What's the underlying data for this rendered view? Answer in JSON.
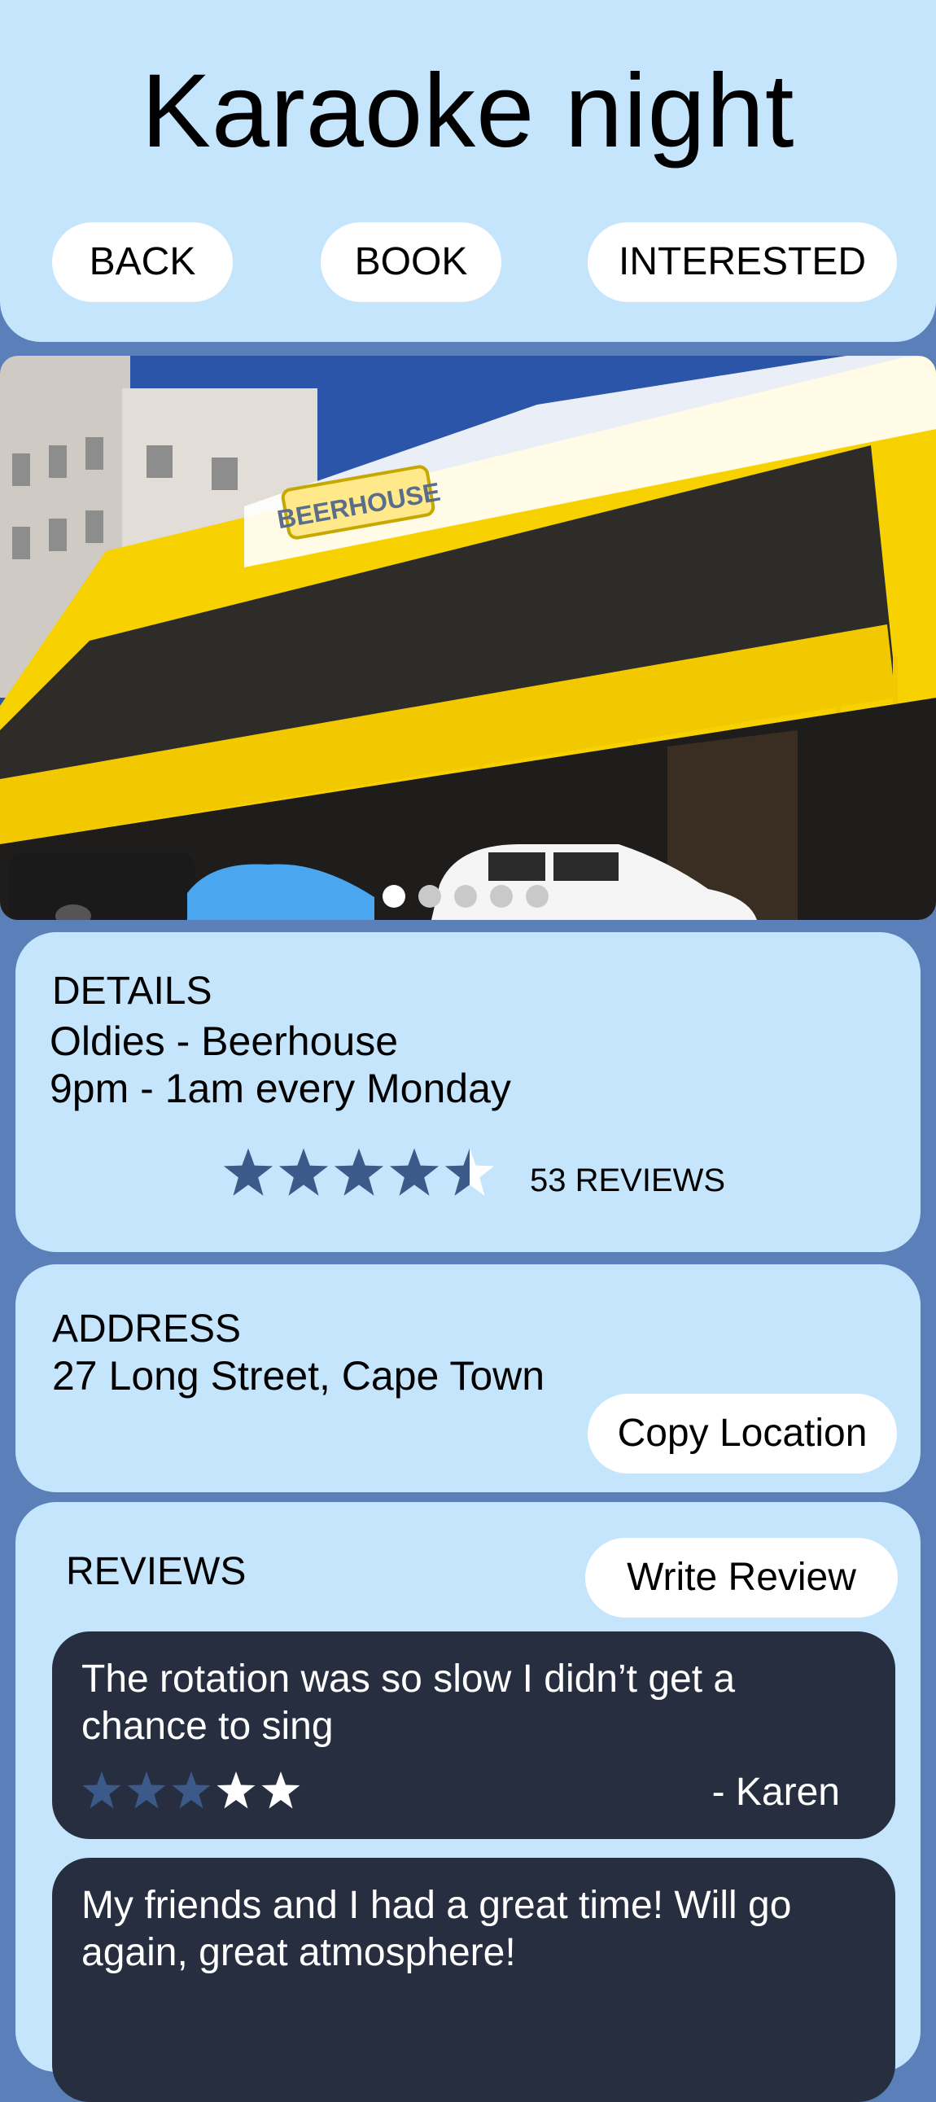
{
  "header": {
    "title": "Karaoke night",
    "back_label": "BACK",
    "book_label": "BOOK",
    "interested_label": "INTERESTED"
  },
  "gallery": {
    "image_name": "beerhouse-photo",
    "sign_text": "BEERHOUSE",
    "slide_count": 5,
    "active_slide": 1
  },
  "details": {
    "heading": "DETAILS",
    "event": "Oldies - Beerhouse",
    "schedule": "9pm - 1am every Monday",
    "rating": 4.5,
    "rating_max": 5,
    "reviews_count_label": "53 REVIEWS"
  },
  "address": {
    "heading": "ADDRESS",
    "value": "27 Long Street, Cape Town",
    "copy_label": "Copy Location"
  },
  "reviews": {
    "heading": "REVIEWS",
    "write_label": "Write Review",
    "items": [
      {
        "text": "The rotation was so slow I didn’t get a chance to sing",
        "rating": 3,
        "rating_max": 5,
        "author": "- Karen"
      },
      {
        "text": "My friends and I had a great time! Will go again, great atmosphere!"
      }
    ]
  },
  "colors": {
    "background": "#5b7fb8",
    "card": "#c4e5fb",
    "review_bg": "#262e40",
    "star_filled": "#3b5a8a",
    "star_empty": "#ffffff"
  }
}
